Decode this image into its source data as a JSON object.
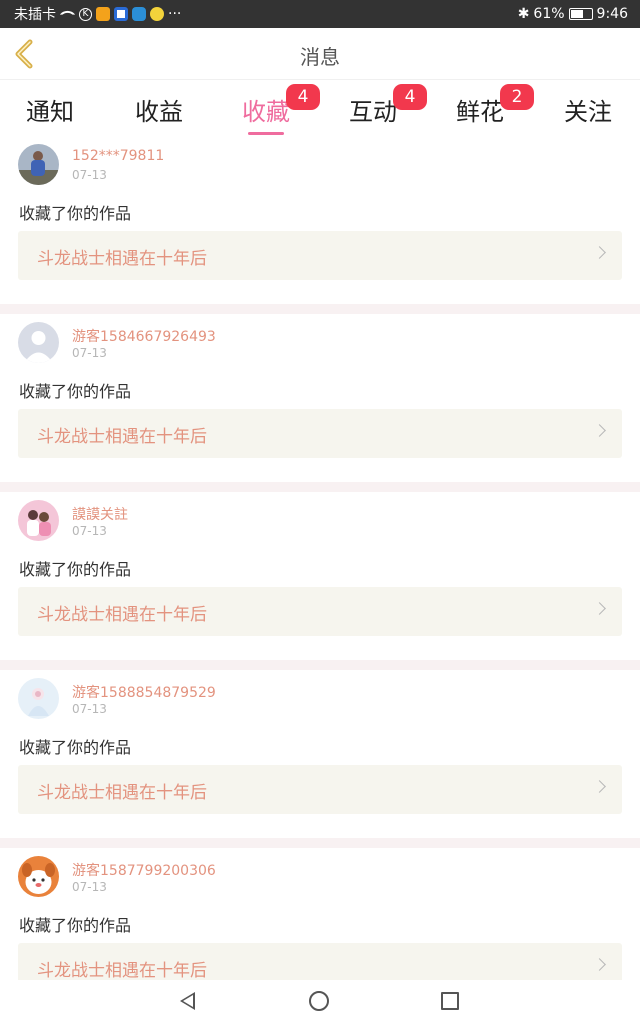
{
  "status_bar": {
    "left_text": "未插卡",
    "more": "···",
    "battery_text": "61%",
    "battery_level": 0.61,
    "time": "9:46",
    "icons": [
      "sim-icon",
      "wifi-icon",
      "k-icon",
      "app-icon-orange",
      "app-icon-blue",
      "app-icon-browser",
      "app-icon-yellow",
      "bluetooth-icon",
      "battery-icon"
    ]
  },
  "header": {
    "title": "消息",
    "back_icon": "chevron-left-icon"
  },
  "tabs": [
    {
      "label": "通知",
      "active": false,
      "badge": ""
    },
    {
      "label": "收益",
      "active": false,
      "badge": ""
    },
    {
      "label": "收藏",
      "active": true,
      "badge": "4"
    },
    {
      "label": "互动",
      "active": false,
      "badge": "4"
    },
    {
      "label": "鲜花",
      "active": false,
      "badge": "2"
    },
    {
      "label": "关注",
      "active": false,
      "badge": ""
    }
  ],
  "items": [
    {
      "user": "152***79811",
      "date": "07-13",
      "action": "收藏了你的作品",
      "work": "斗龙战士相遇在十年后",
      "avatar": "photo-avatar"
    },
    {
      "user": "游客1584667926493",
      "date": "07-13",
      "action": "收藏了你的作品",
      "work": "斗龙战士相遇在十年后",
      "avatar": "default-avatar"
    },
    {
      "user": "謨謨关註",
      "date": "07-13",
      "action": "收藏了你的作品",
      "work": "斗龙战士相遇在十年后",
      "avatar": "pink-avatar"
    },
    {
      "user": "游客1588854879529",
      "date": "07-13",
      "action": "收藏了你的作品",
      "work": "斗龙战士相遇在十年后",
      "avatar": "light-avatar"
    },
    {
      "user": "游客1587799200306",
      "date": "07-13",
      "action": "收藏了你的作品",
      "work": "斗龙战士相遇在十年后",
      "avatar": "cartoon-avatar"
    }
  ],
  "colors": {
    "accent": "#ef6c9e",
    "badge": "#f2384d",
    "username": "#e3937f",
    "work_box": "#f6f5ee",
    "divider": "#f8f1f2"
  },
  "nav_bar": [
    "back-triangle-icon",
    "home-circle-icon",
    "recent-square-icon"
  ]
}
